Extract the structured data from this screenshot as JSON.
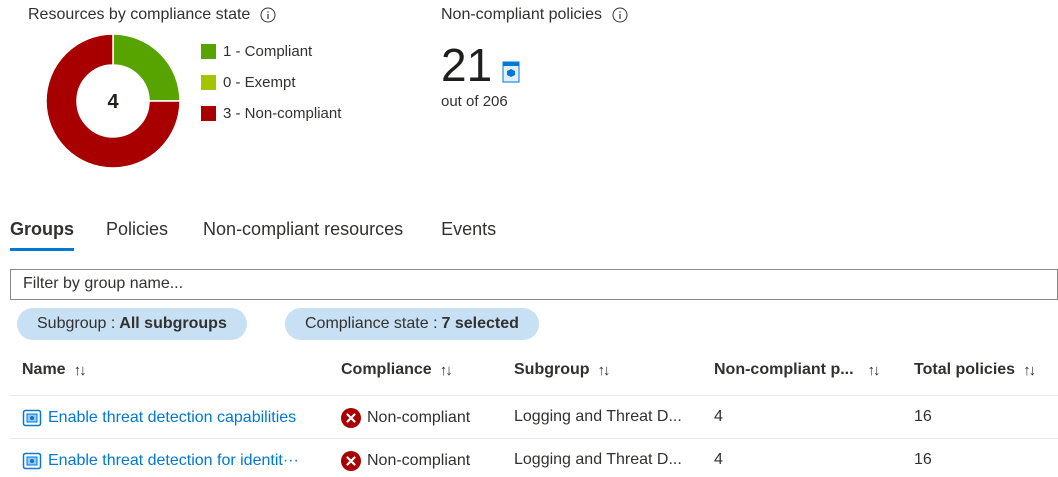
{
  "summary": {
    "compliance_title": "Resources by compliance state",
    "donut_total": "4",
    "legend": [
      {
        "label": "1 - Compliant",
        "value": 1,
        "color": "#57a300"
      },
      {
        "label": "0 - Exempt",
        "value": 0,
        "color": "#a4c400"
      },
      {
        "label": "3 - Non-compliant",
        "value": 3,
        "color": "#a80000"
      }
    ],
    "policies_title": "Non-compliant policies",
    "noncompliant_count": "21",
    "out_of": "out of 206"
  },
  "tabs": [
    {
      "label": "Groups",
      "active": true
    },
    {
      "label": "Policies",
      "active": false
    },
    {
      "label": "Non-compliant resources",
      "active": false
    },
    {
      "label": "Events",
      "active": false
    }
  ],
  "filter": {
    "placeholder": "Filter by group name..."
  },
  "pills": [
    {
      "key": "Subgroup :",
      "value": "All subgroups"
    },
    {
      "key": "Compliance state :",
      "value": "7 selected"
    }
  ],
  "table": {
    "headers": {
      "name": "Name",
      "compliance": "Compliance",
      "subgroup": "Subgroup",
      "noncompliant": "Non-compliant p...",
      "total": "Total policies"
    },
    "sort_glyph": "↑↓",
    "rows": [
      {
        "name": "Enable threat detection capabilities",
        "compliance": "Non-compliant",
        "subgroup": "Logging and Threat D...",
        "noncompliant": "4",
        "total": "16"
      },
      {
        "name": "Enable threat detection for identit···",
        "compliance": "Non-compliant",
        "subgroup": "Logging and Threat D...",
        "noncompliant": "4",
        "total": "16"
      }
    ]
  }
}
